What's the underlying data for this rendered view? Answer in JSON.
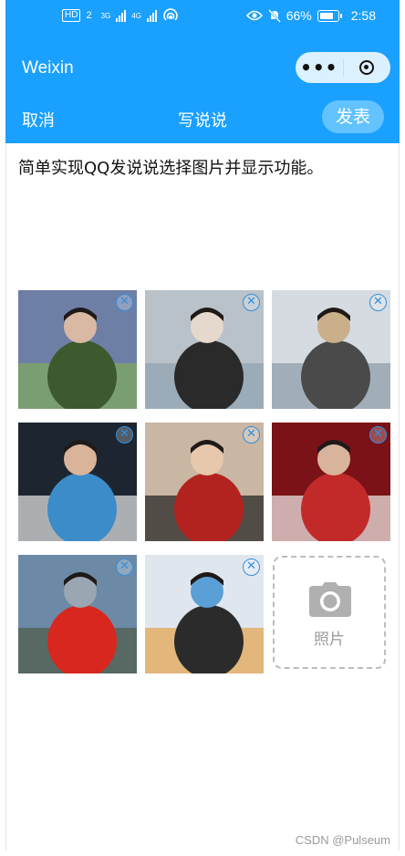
{
  "status_bar": {
    "network_left": "HD",
    "sim": "2",
    "signal1_label": "3G",
    "signal2_label": "4G",
    "battery": "66%",
    "time": "2:58"
  },
  "nav": {
    "title": "Weixin",
    "more_icon": "more-dots-icon",
    "close_icon": "target-circle-icon"
  },
  "toolbar": {
    "cancel": "取消",
    "title": "写说说",
    "publish": "发表"
  },
  "post_text": "简单实现QQ发说说选择图片并显示功能。",
  "photos": [
    {
      "name": "photo-1",
      "colors": [
        "#6e7fa6",
        "#3c5a2e",
        "#7fa95b",
        "#d9b8a4"
      ]
    },
    {
      "name": "photo-2",
      "colors": [
        "#b9c2c8",
        "#2a2a2a",
        "#8fa1b0",
        "#e5d8cc"
      ]
    },
    {
      "name": "photo-3",
      "colors": [
        "#d5dbe0",
        "#4a4a4a",
        "#8a9aa8",
        "#c9b08a"
      ]
    },
    {
      "name": "photo-4",
      "colors": [
        "#1d2630",
        "#3b8cc8",
        "#e9e9ea",
        "#d9b39a"
      ]
    },
    {
      "name": "photo-5",
      "colors": [
        "#c9b6a3",
        "#b2231f",
        "#202020",
        "#e7c8ad"
      ]
    },
    {
      "name": "photo-6",
      "colors": [
        "#7a1217",
        "#c22a2a",
        "#f2f0ee",
        "#d9b49c"
      ]
    },
    {
      "name": "photo-7",
      "colors": [
        "#6c8aa6",
        "#d8271f",
        "#4f5b46",
        "#9aa7b3"
      ]
    },
    {
      "name": "photo-8",
      "colors": [
        "#dfe6ee",
        "#2b2b2b",
        "#e4a24b",
        "#5aa0d6"
      ]
    }
  ],
  "add_photo": {
    "label": "照片",
    "icon": "camera-icon"
  },
  "watermark": "CSDN @Pulseum",
  "colors": {
    "accent": "#1aa0ff",
    "publish_bg": "#62c3ff",
    "delete_icon": "#2f8fe0"
  }
}
